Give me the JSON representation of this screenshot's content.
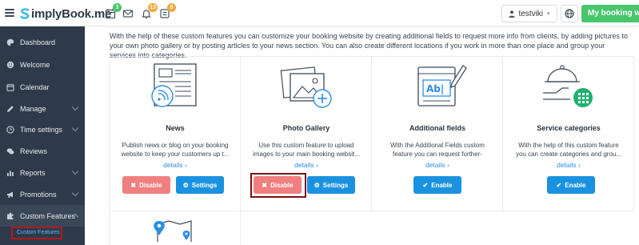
{
  "header": {
    "logo_text": "implyBook.me",
    "badges": {
      "calendar": "3",
      "bell": "13",
      "tasks": "8"
    },
    "user_name": "testviki",
    "site_button": "My booking website"
  },
  "sidebar": {
    "items": [
      {
        "label": "Dashboard",
        "icon": "palette-icon"
      },
      {
        "label": "Welcome",
        "icon": "smile-icon"
      },
      {
        "label": "Calendar",
        "icon": "calendar-icon"
      },
      {
        "label": "Manage",
        "icon": "pencil-icon"
      },
      {
        "label": "Time settings",
        "icon": "clock-icon"
      },
      {
        "label": "Reviews",
        "icon": "chat-icon"
      },
      {
        "label": "Reports",
        "icon": "bar-chart-icon"
      },
      {
        "label": "Promotions",
        "icon": "megaphone-icon"
      },
      {
        "label": "Custom Features",
        "icon": "puzzle-icon"
      }
    ],
    "sub_item": "Custom Features"
  },
  "main": {
    "intro": "With the help of these custom features you can customize your booking website by creating additional fields to request more info from clients, by adding pictures to your own photo gallery or by posting articles to your news section. You can also create different locations if you work in more than one place and group your services into categories.",
    "cards": [
      {
        "title": "News",
        "desc": "Publish news or blog on your booking website to keep your customers up t...",
        "details": "details",
        "buttons": [
          "Disable",
          "Settings"
        ]
      },
      {
        "title": "Photo Gallery",
        "desc": "Use this custom feature to upload images to your main booking websit...",
        "details": "details",
        "buttons": [
          "Disable",
          "Settings"
        ]
      },
      {
        "title": "Additional fields",
        "desc": "With the Additional Fields custom feature you can request further-",
        "details": "details",
        "buttons": [
          "Enable"
        ]
      },
      {
        "title": "Service categories",
        "desc": "With the help of this custom feature you can create categories and grou...",
        "details": "details",
        "buttons": [
          "Enable"
        ]
      }
    ]
  },
  "colors": {
    "sidebar_bg": "#2e3a49",
    "accent_green": "#48c66c",
    "accent_blue": "#1b92e0",
    "disable_red": "#f07f7f",
    "highlight_border": "#7a1013"
  }
}
